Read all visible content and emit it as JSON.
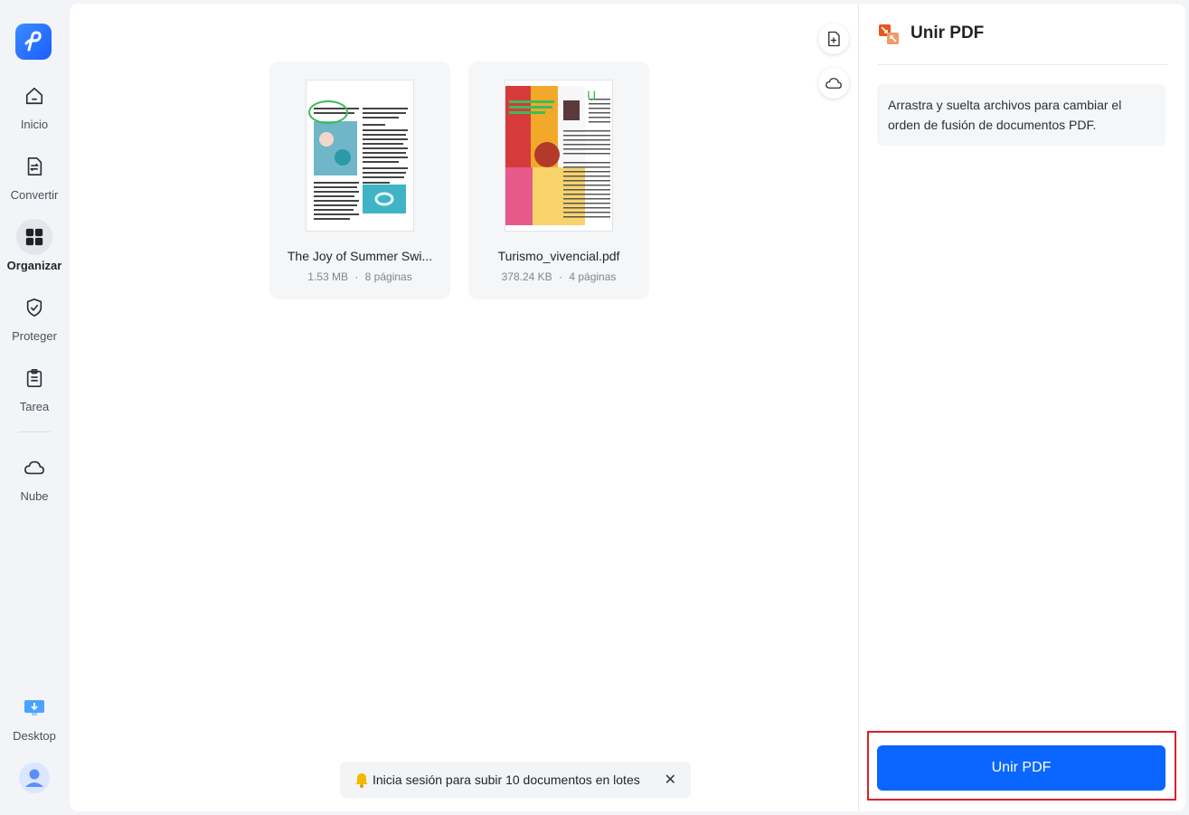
{
  "sidebar": {
    "items": [
      {
        "label": "Inicio",
        "icon": "home-icon"
      },
      {
        "label": "Convertir",
        "icon": "convert-icon"
      },
      {
        "label": "Organizar",
        "icon": "grid-icon",
        "active": true
      },
      {
        "label": "Proteger",
        "icon": "shield-icon"
      },
      {
        "label": "Tarea",
        "icon": "clipboard-icon"
      },
      {
        "label": "Nube",
        "icon": "cloud-icon"
      },
      {
        "label": "Desktop",
        "icon": "desktop-icon"
      }
    ]
  },
  "files": [
    {
      "name": "The Joy of Summer Swi...",
      "size": "1.53 MB",
      "pages": "8 páginas"
    },
    {
      "name": "Turismo_vivencial.pdf",
      "size": "378.24 KB",
      "pages": "4 páginas"
    }
  ],
  "meta_separator": "·",
  "toast": {
    "text": "Inicia sesión para subir 10 documentos en lotes",
    "close": "✕"
  },
  "right_panel": {
    "title": "Unir PDF",
    "info": "Arrastra y suelta archivos para cambiar el orden de fusión de documentos PDF.",
    "button_label": "Unir PDF"
  },
  "colors": {
    "accent": "#0a66ff",
    "highlight": "#d8202e",
    "merge_icon": "#e8561f"
  }
}
